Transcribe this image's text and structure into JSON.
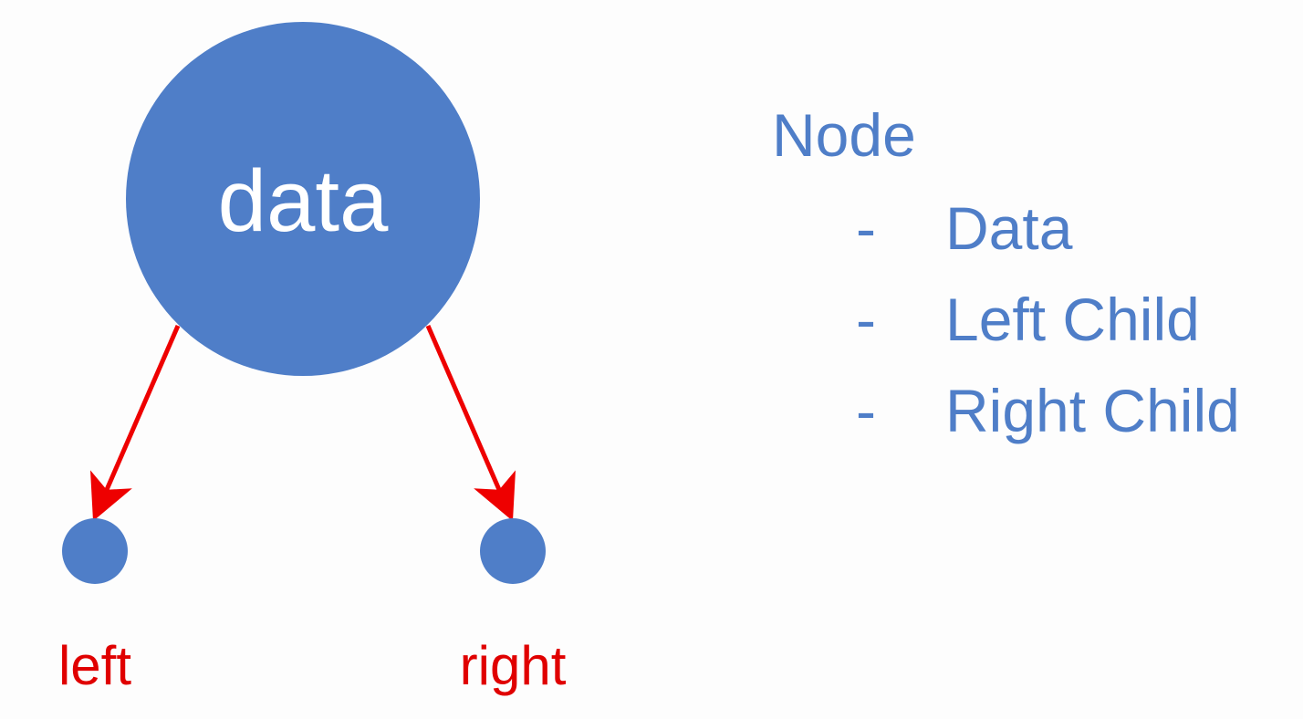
{
  "colors": {
    "node_fill": "#4f7ec8",
    "node_text": "#ffffff",
    "arrow": "#ee0000",
    "label": "#e00000",
    "heading_text": "#4f7ec8"
  },
  "diagram": {
    "root_node": {
      "label": "data"
    },
    "children": [
      {
        "label": "left"
      },
      {
        "label": "right"
      }
    ]
  },
  "description": {
    "heading": "Node",
    "items": [
      {
        "bullet": "-",
        "text": "Data"
      },
      {
        "bullet": "-",
        "text": "Left Child"
      },
      {
        "bullet": "-",
        "text": "Right Child"
      }
    ]
  }
}
